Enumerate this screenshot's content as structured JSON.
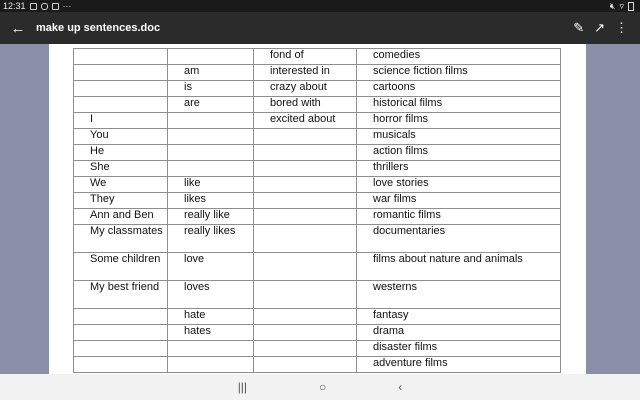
{
  "status_bar": {
    "time": "12:31",
    "more": "···"
  },
  "app_bar": {
    "back_glyph": "←",
    "title": "make up sentences.doc",
    "edit_glyph": "✎",
    "open_glyph": "↗",
    "menu_glyph": "⋮"
  },
  "table": {
    "rows": [
      [
        "",
        "",
        "fond of",
        "comedies"
      ],
      [
        "",
        "am",
        "interested in",
        "science fiction films"
      ],
      [
        "",
        "is",
        "crazy about",
        "cartoons"
      ],
      [
        "",
        "are",
        "bored with",
        "historical films"
      ],
      [
        "I",
        "",
        "excited about",
        "horror films"
      ],
      [
        "You",
        "",
        "",
        "musicals"
      ],
      [
        "He",
        "",
        "",
        "action films"
      ],
      [
        "She",
        "",
        "",
        "thrillers"
      ],
      [
        "We",
        "like",
        "",
        "love stories"
      ],
      [
        "They",
        "likes",
        "",
        "war films"
      ],
      [
        "Ann and Ben",
        "really like",
        "",
        "romantic films"
      ],
      [
        "My classmates",
        "really likes",
        "",
        "documentaries"
      ],
      [
        "Some children",
        "love",
        "",
        "films about nature and animals"
      ],
      [
        "My best friend",
        "loves",
        "",
        "westerns"
      ],
      [
        "",
        "hate",
        "",
        "fantasy"
      ],
      [
        "",
        "hates",
        "",
        "drama"
      ],
      [
        "",
        "",
        "",
        "disaster films"
      ],
      [
        "",
        "",
        "",
        "adventure films"
      ]
    ]
  },
  "nav_bar": {
    "recents_glyph": "|||",
    "home_glyph": "○",
    "back_glyph": "‹"
  }
}
